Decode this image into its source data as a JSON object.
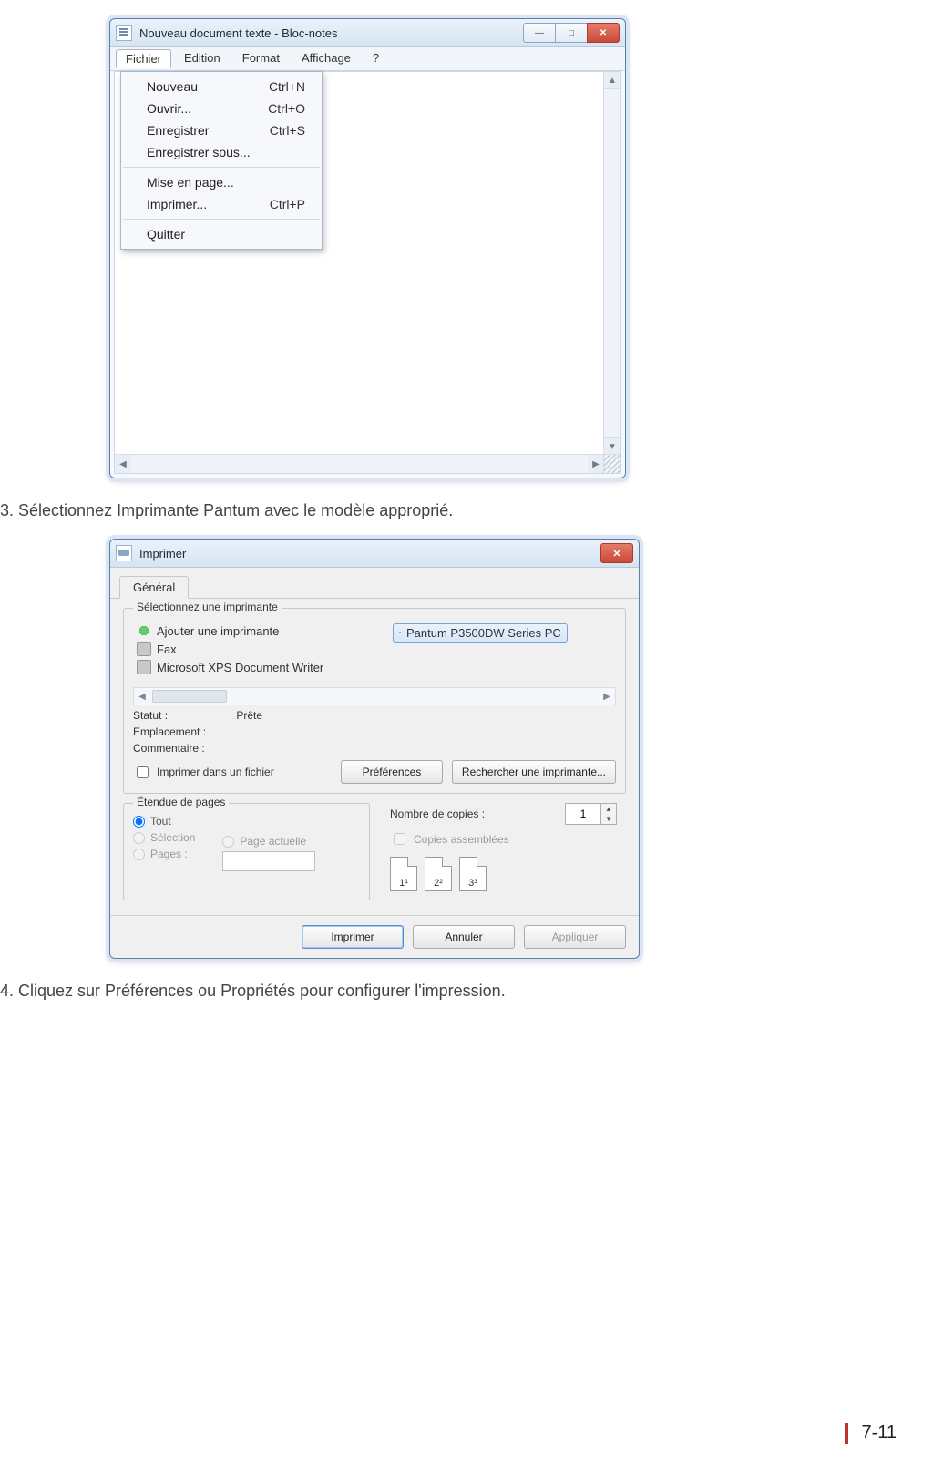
{
  "instructions": {
    "step3": "3. Sélectionnez Imprimante Pantum avec le modèle approprié.",
    "step4": "4. Cliquez sur Préférences ou Propriétés pour configurer l'impression."
  },
  "notepad": {
    "title": "Nouveau document texte - Bloc-notes",
    "menu": {
      "fichier": "Fichier",
      "edition": "Edition",
      "format": "Format",
      "affichage": "Affichage",
      "aide": "?"
    },
    "fichier_items": [
      {
        "label": "Nouveau",
        "shortcut": "Ctrl+N"
      },
      {
        "label": "Ouvrir...",
        "shortcut": "Ctrl+O"
      },
      {
        "label": "Enregistrer",
        "shortcut": "Ctrl+S"
      },
      {
        "label": "Enregistrer sous...",
        "shortcut": ""
      }
    ],
    "fichier_items2": [
      {
        "label": "Mise en page...",
        "shortcut": ""
      },
      {
        "label": "Imprimer...",
        "shortcut": "Ctrl+P"
      }
    ],
    "fichier_items3": [
      {
        "label": "Quitter",
        "shortcut": ""
      }
    ]
  },
  "print": {
    "title": "Imprimer",
    "tab": "Général",
    "group_select": "Sélectionnez une imprimante",
    "printers": {
      "add": "Ajouter une imprimante",
      "fax": "Fax",
      "xps": "Microsoft XPS Document Writer",
      "pantum": "Pantum P3500DW Series PC"
    },
    "status_label": "Statut :",
    "status_value": "Prête",
    "location_label": "Emplacement :",
    "comment_label": "Commentaire :",
    "print_to_file": "Imprimer dans un fichier",
    "prefs_btn": "Préférences",
    "find_btn": "Rechercher une imprimante...",
    "range_group": "Étendue de pages",
    "range": {
      "all": "Tout",
      "selection": "Sélection",
      "current": "Page actuelle",
      "pages": "Pages :"
    },
    "copies_label": "Nombre de copies :",
    "copies_value": "1",
    "collate": "Copies assemblées",
    "collate_nums": {
      "a": "1¹",
      "b": "2²",
      "c": "3³"
    },
    "buttons": {
      "print": "Imprimer",
      "cancel": "Annuler",
      "apply": "Appliquer"
    }
  },
  "page_number": "7-11"
}
